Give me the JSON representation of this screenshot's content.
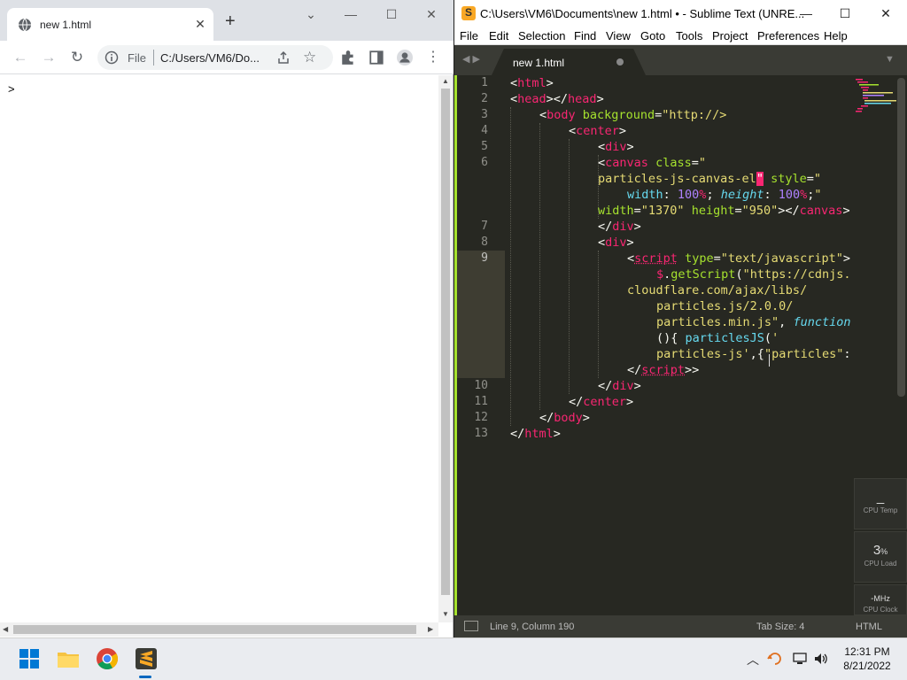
{
  "chrome": {
    "tab_title": "new 1.html",
    "omnibox": {
      "scheme": "File",
      "url": "C:/Users/VM6/Do..."
    },
    "content_text": ">"
  },
  "sublime": {
    "title": "C:\\Users\\VM6\\Documents\\new 1.html • - Sublime Text (UNRE...",
    "menu": [
      "File",
      "Edit",
      "Selection",
      "Find",
      "View",
      "Goto",
      "Tools",
      "Project",
      "Preferences",
      "Help"
    ],
    "tab_name": "new 1.html",
    "line_numbers": [
      "1",
      "2",
      "3",
      "4",
      "5",
      "6",
      "7",
      "8",
      "9",
      "10",
      "11",
      "12",
      "13"
    ],
    "status": {
      "position": "Line 9, Column 190",
      "tab_size": "Tab Size: 4",
      "syntax": "HTML"
    },
    "widgets": [
      {
        "value": "_",
        "unit": "",
        "label": "CPU Temp"
      },
      {
        "value": "3",
        "unit": "%",
        "label": "CPU Load"
      },
      {
        "value": "-",
        "unit": "MHz",
        "label": "CPU Clock"
      }
    ]
  },
  "taskbar": {
    "time": "12:31 PM",
    "date": "8/21/2022"
  },
  "colors": {
    "tag": "#f92672",
    "attr": "#a6e22e",
    "string": "#e6db74",
    "number": "#ae81ff",
    "keyword": "#66d9ef"
  }
}
